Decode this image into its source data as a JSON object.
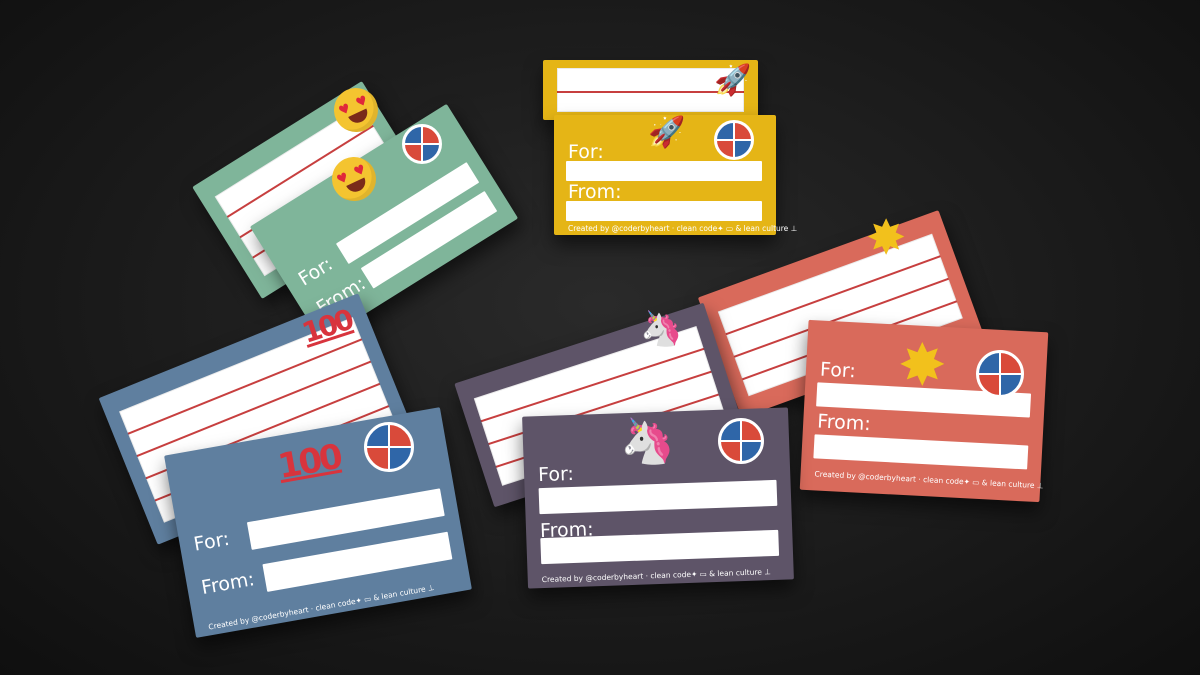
{
  "cards": {
    "label_for": "For:",
    "label_from": "From:",
    "credit": "Created by @coderbyheart · clean code✦ ▭ & lean culture ⊥",
    "icons": {
      "love": "heart-eyes-emoji-icon",
      "rocket": "rocket-icon",
      "hundred": "hundred-points-icon",
      "hundred_text": "100",
      "unicorn": "unicorn-icon",
      "star": "star-icon",
      "badge": "circular-logo-badge-icon"
    },
    "colors": {
      "green": "#7fb59a",
      "yellow": "#e5b516",
      "red": "#d96a5b",
      "blue": "#5f7f9f",
      "purple": "#5e5468",
      "lines": "#c73f3f"
    }
  }
}
